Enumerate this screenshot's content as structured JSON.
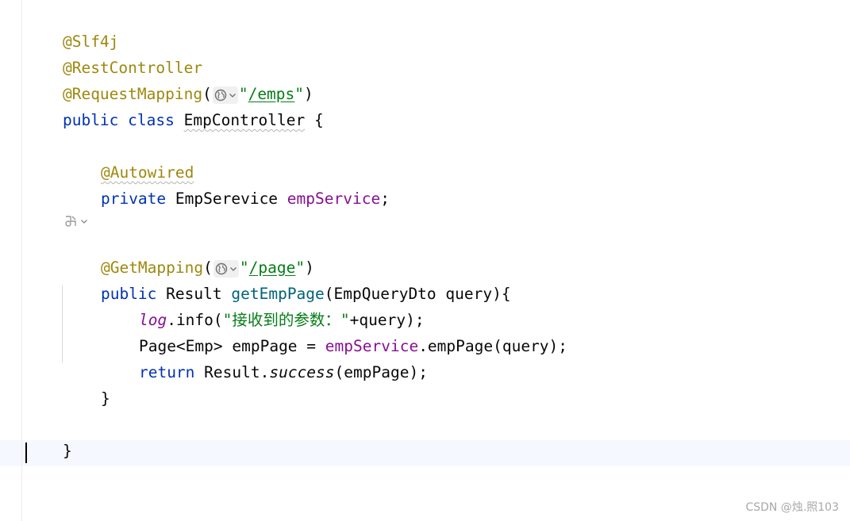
{
  "code": {
    "l1_annotation": "@Slf4j",
    "l2_annotation": "@RestController",
    "l3_annotation": "@RequestMapping",
    "l3_open": "(",
    "l3_quote_open": "\"",
    "l3_path": "/emps",
    "l3_quote_close": "\"",
    "l3_close": ")",
    "l4_public": "public",
    "l4_class": "class",
    "l4_name": "EmpController",
    "l4_brace": "{",
    "l6_annotation": "@Autowired",
    "l7_private": "private",
    "l7_type": "EmpSerevice",
    "l7_field": "empService",
    "l7_semicolon": ";",
    "l9_annotation": "@GetMapping",
    "l9_open": "(",
    "l9_quote_open": "\"",
    "l9_path": "/page",
    "l9_quote_close": "\"",
    "l9_close": ")",
    "l10_public": "public",
    "l10_type": "Result",
    "l10_method": "getEmpPage",
    "l10_params": "(EmpQueryDto query){",
    "l11_log": "log",
    "l11_call": ".info(",
    "l11_str_q1": "\"",
    "l11_str_text": "接收到的参数：",
    "l11_str_q2": "\"",
    "l11_rest": "+query);",
    "l12_start": "Page<Emp> empPage = ",
    "l12_field": "empService",
    "l12_end": ".empPage(query);",
    "l13_return": "return",
    "l13_mid": " Result.",
    "l13_method": "success",
    "l13_end": "(empPage);",
    "l14_brace": "}",
    "l16_brace": "}"
  },
  "icons": {
    "endpoint_hint": "globe-icon",
    "dropdown": "chevron-down-icon",
    "gutter": "endpoint-gutter-icon"
  },
  "watermark": "CSDN @烛.照103",
  "colors": {
    "annotation": "#9e880d",
    "keyword": "#0033b3",
    "string": "#067d17",
    "field": "#871094",
    "method": "#00627a",
    "caret_row": "#f5f8fe"
  }
}
